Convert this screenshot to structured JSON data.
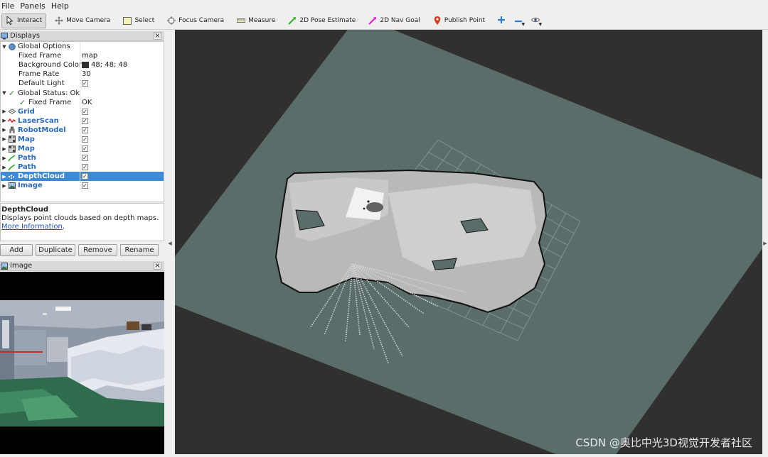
{
  "menu": {
    "file": "File",
    "panels": "Panels",
    "help": "Help"
  },
  "toolbar": {
    "interact": "Interact",
    "move_camera": "Move Camera",
    "select": "Select",
    "focus_camera": "Focus Camera",
    "measure": "Measure",
    "pose_estimate": "2D Pose Estimate",
    "nav_goal": "2D Nav Goal",
    "publish_point": "Publish Point"
  },
  "displays_panel": {
    "title": "Displays",
    "global_options": {
      "label": "Global Options",
      "fixed_frame_label": "Fixed Frame",
      "fixed_frame_value": "map",
      "bg_color_label": "Background Color",
      "bg_color_value": "48; 48; 48",
      "frame_rate_label": "Frame Rate",
      "frame_rate_value": "30",
      "default_light_label": "Default Light"
    },
    "global_status": {
      "label": "Global Status: Ok",
      "fixed_frame_label": "Fixed Frame",
      "fixed_frame_value": "OK"
    },
    "displays": [
      {
        "name": "Grid",
        "icon": "grid-icon"
      },
      {
        "name": "LaserScan",
        "icon": "laserscan-icon"
      },
      {
        "name": "RobotModel",
        "icon": "robot-model-icon"
      },
      {
        "name": "Map",
        "icon": "map-icon"
      },
      {
        "name": "Map",
        "icon": "map-icon"
      },
      {
        "name": "Path",
        "icon": "path-icon"
      },
      {
        "name": "Path",
        "icon": "path-icon"
      },
      {
        "name": "DepthCloud",
        "icon": "depth-cloud-icon"
      },
      {
        "name": "Image",
        "icon": "image-icon"
      }
    ],
    "description": {
      "title": "DepthCloud",
      "text": "Displays point clouds based on depth maps.",
      "link": "More Information",
      "link_suffix": "."
    },
    "buttons": {
      "add": "Add",
      "duplicate": "Duplicate",
      "remove": "Remove",
      "rename": "Rename"
    }
  },
  "image_panel": {
    "title": "Image"
  },
  "watermark": "CSDN @奥比中光3D视觉开发者社区",
  "colors": {
    "selection": "#3d8ad7",
    "link": "#1a55c9",
    "background": "#303030",
    "ground": "#5b6d6b"
  }
}
